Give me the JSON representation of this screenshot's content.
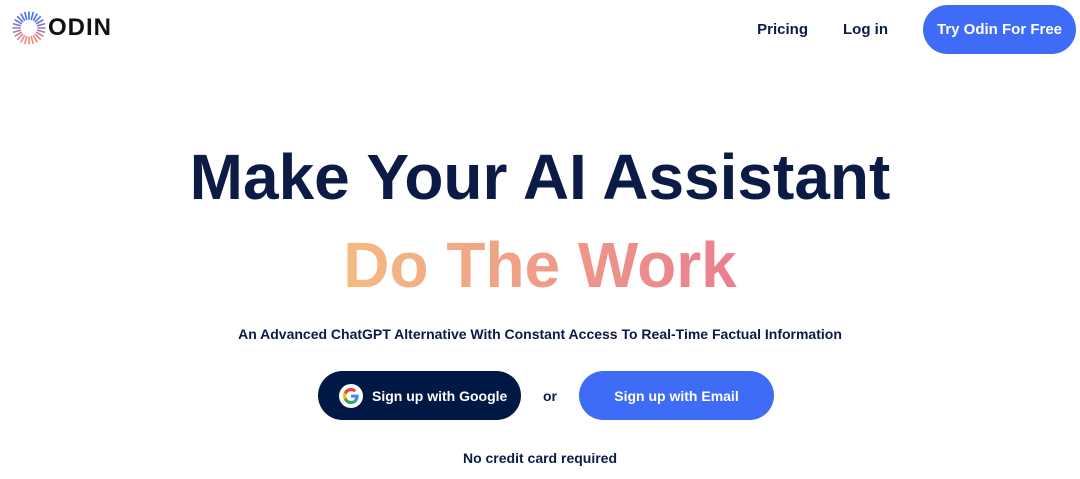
{
  "brand": {
    "name": "ODIN"
  },
  "nav": {
    "pricing": "Pricing",
    "login": "Log in",
    "cta": "Try Odin For Free"
  },
  "hero": {
    "title": "Make Your AI Assistant",
    "highlight": "Do The Work",
    "subtitle": "An Advanced ChatGPT Alternative With Constant Access To Real-Time Factual Information",
    "google_button": "Sign up with Google",
    "or": "or",
    "email_button": "Sign up with Email",
    "note": "No credit card required"
  },
  "colors": {
    "navy": "#0b1b45",
    "accent": "#3e6cf6",
    "gradient_start": "#f5bb80",
    "gradient_end": "#e97e90"
  }
}
